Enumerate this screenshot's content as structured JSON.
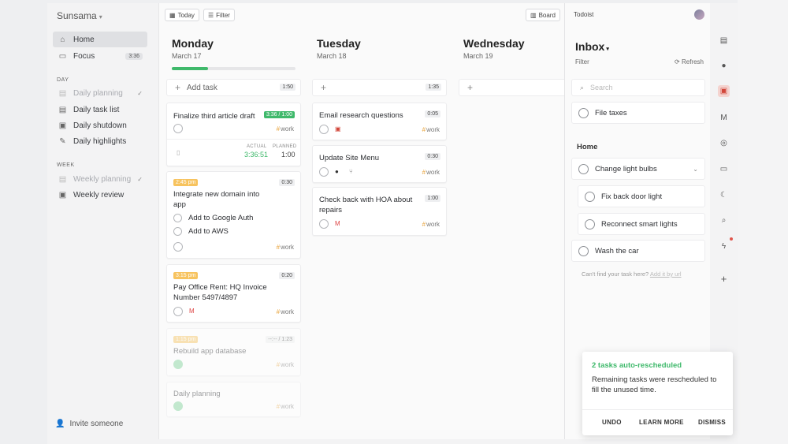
{
  "sidebar": {
    "brand": "Sunsama",
    "home": "Home",
    "focus": "Focus",
    "focus_badge": "3:36",
    "section_day": "DAY",
    "daily_planning": "Daily planning",
    "daily_task_list": "Daily task list",
    "daily_shutdown": "Daily shutdown",
    "daily_highlights": "Daily highlights",
    "section_week": "WEEK",
    "weekly_planning": "Weekly planning",
    "weekly_review": "Weekly review",
    "invite": "Invite someone"
  },
  "toolbar": {
    "today": "Today",
    "filter": "Filter",
    "board": "Board"
  },
  "days": [
    {
      "name": "Monday",
      "date": "March 17",
      "add_label": "Add task",
      "add_time": "1:50",
      "progress": 0.29
    },
    {
      "name": "Tuesday",
      "date": "March 18",
      "add_time": "1:35"
    },
    {
      "name": "Wednesday",
      "date": "March 19"
    }
  ],
  "monday": {
    "t1": {
      "title": "Finalize third article draft",
      "chip": "3:36 / 1:00",
      "tag": "work",
      "actual_lbl": "ACTUAL",
      "actual": "3:36:51",
      "planned_lbl": "PLANNED",
      "planned": "1:00"
    },
    "t2": {
      "time": "2:45 pm",
      "title": "Integrate new domain into app",
      "chip": "0:30",
      "sub1": "Add to Google Auth",
      "sub2": "Add to AWS",
      "tag": "work"
    },
    "t3": {
      "time": "3:15 pm",
      "title": "Pay Office Rent: HQ Invoice Number 5497/4897",
      "chip": "0:20",
      "tag": "work"
    },
    "t4": {
      "time": "1:15 pm",
      "title": "Rebuild app database",
      "chip": "--:-- / 1:23",
      "tag": "work"
    },
    "t5": {
      "title": "Daily planning",
      "tag": "work"
    }
  },
  "tuesday": {
    "t1": {
      "title": "Email research questions",
      "chip": "0:05",
      "tag": "work"
    },
    "t2": {
      "title": "Update Site Menu",
      "chip": "0:30",
      "tag": "work"
    },
    "t3": {
      "title": "Check back with HOA about repairs",
      "chip": "1:00",
      "tag": "work"
    }
  },
  "todoist": {
    "header": "Todoist",
    "inbox": "Inbox",
    "filter": "Filter",
    "refresh": "Refresh",
    "search_placeholder": "Search",
    "item_file_taxes": "File taxes",
    "group_home": "Home",
    "item_bulbs": "Change light bulbs",
    "item_backdoor": "Fix back door light",
    "item_smart": "Reconnect smart lights",
    "item_car": "Wash the car",
    "cant_find": "Can't find your task here?",
    "add_by_url": "Add it by url"
  },
  "toast": {
    "title": "2 tasks auto-rescheduled",
    "body": "Remaining tasks were rescheduled to fill the unused time.",
    "undo": "UNDO",
    "learn": "LEARN MORE",
    "dismiss": "DISMISS"
  },
  "colors": {
    "accent_green": "#3fb96b",
    "tag_hash": "#e8a33b",
    "time_badge": "#f7c35e"
  },
  "icons": [
    "home-icon",
    "focus-icon",
    "calendar-icon",
    "list-icon",
    "shutdown-icon",
    "highlight-icon",
    "invite-icon",
    "github-icon",
    "gmail-icon",
    "todoist-icon",
    "search-icon",
    "plus-icon"
  ]
}
